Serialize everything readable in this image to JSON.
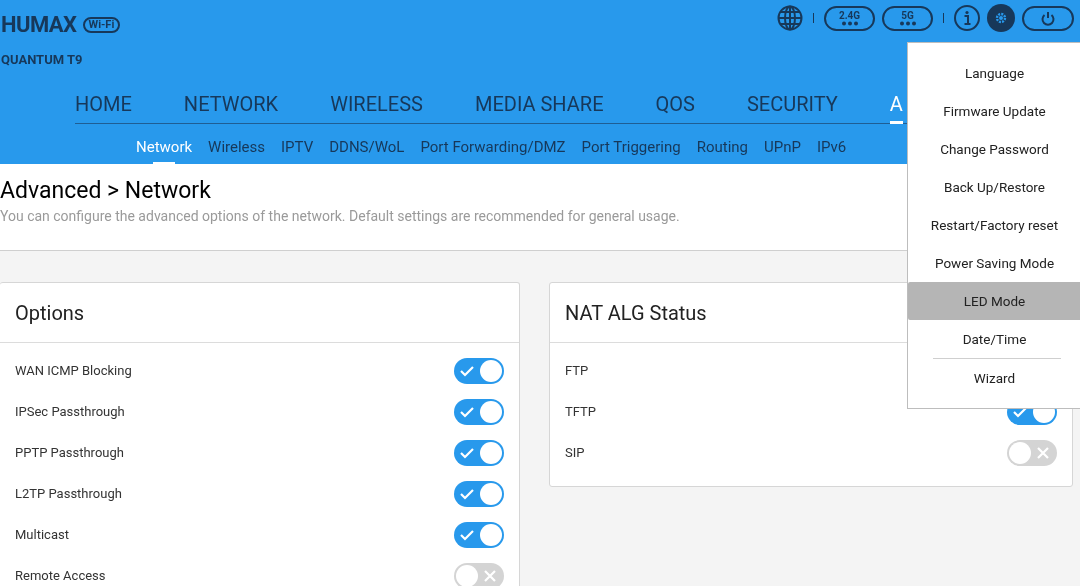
{
  "header": {
    "brand": "HUMAX",
    "badge": "Wi-Fi",
    "model": "QUANTUM T9",
    "bands": [
      "2.4G",
      "5G"
    ]
  },
  "nav": [
    {
      "label": "HOME",
      "selected": false
    },
    {
      "label": "NETWORK",
      "selected": false
    },
    {
      "label": "WIRELESS",
      "selected": false
    },
    {
      "label": "MEDIA SHARE",
      "selected": false
    },
    {
      "label": "QOS",
      "selected": false
    },
    {
      "label": "SECURITY",
      "selected": false
    },
    {
      "label": "A",
      "selected": true
    }
  ],
  "subnav": [
    {
      "label": "Network",
      "selected": true
    },
    {
      "label": "Wireless",
      "selected": false
    },
    {
      "label": "IPTV",
      "selected": false
    },
    {
      "label": "DDNS/WoL",
      "selected": false
    },
    {
      "label": "Port Forwarding/DMZ",
      "selected": false
    },
    {
      "label": "Port Triggering",
      "selected": false
    },
    {
      "label": "Routing",
      "selected": false
    },
    {
      "label": "UPnP",
      "selected": false
    },
    {
      "label": "IPv6",
      "selected": false
    }
  ],
  "page": {
    "title": "Advanced > Network",
    "subtitle": "You can configure the advanced options of the network. Default settings are recommended for general usage."
  },
  "cards": [
    {
      "title": "Options",
      "rows": [
        {
          "label": "WAN ICMP Blocking",
          "on": true
        },
        {
          "label": "IPSec Passthrough",
          "on": true
        },
        {
          "label": "PPTP Passthrough",
          "on": true
        },
        {
          "label": "L2TP Passthrough",
          "on": true
        },
        {
          "label": "Multicast",
          "on": true
        },
        {
          "label": "Remote Access",
          "on": false
        }
      ]
    },
    {
      "title": "NAT ALG Status",
      "rows": [
        {
          "label": "FTP"
        },
        {
          "label": "TFTP",
          "on": true
        },
        {
          "label": "SIP",
          "on": false
        }
      ]
    }
  ],
  "menu": [
    {
      "label": "Language",
      "selected": false
    },
    {
      "label": "Firmware Update",
      "selected": false
    },
    {
      "label": "Change Password",
      "selected": false
    },
    {
      "label": "Back Up/Restore",
      "selected": false
    },
    {
      "label": "Restart/Factory reset",
      "selected": false
    },
    {
      "label": "Power Saving Mode",
      "selected": false
    },
    {
      "label": "LED Mode",
      "selected": true
    },
    {
      "label": "Date/Time",
      "selected": false
    },
    {
      "label": "Wizard",
      "selected": false,
      "divider_before": true
    }
  ]
}
